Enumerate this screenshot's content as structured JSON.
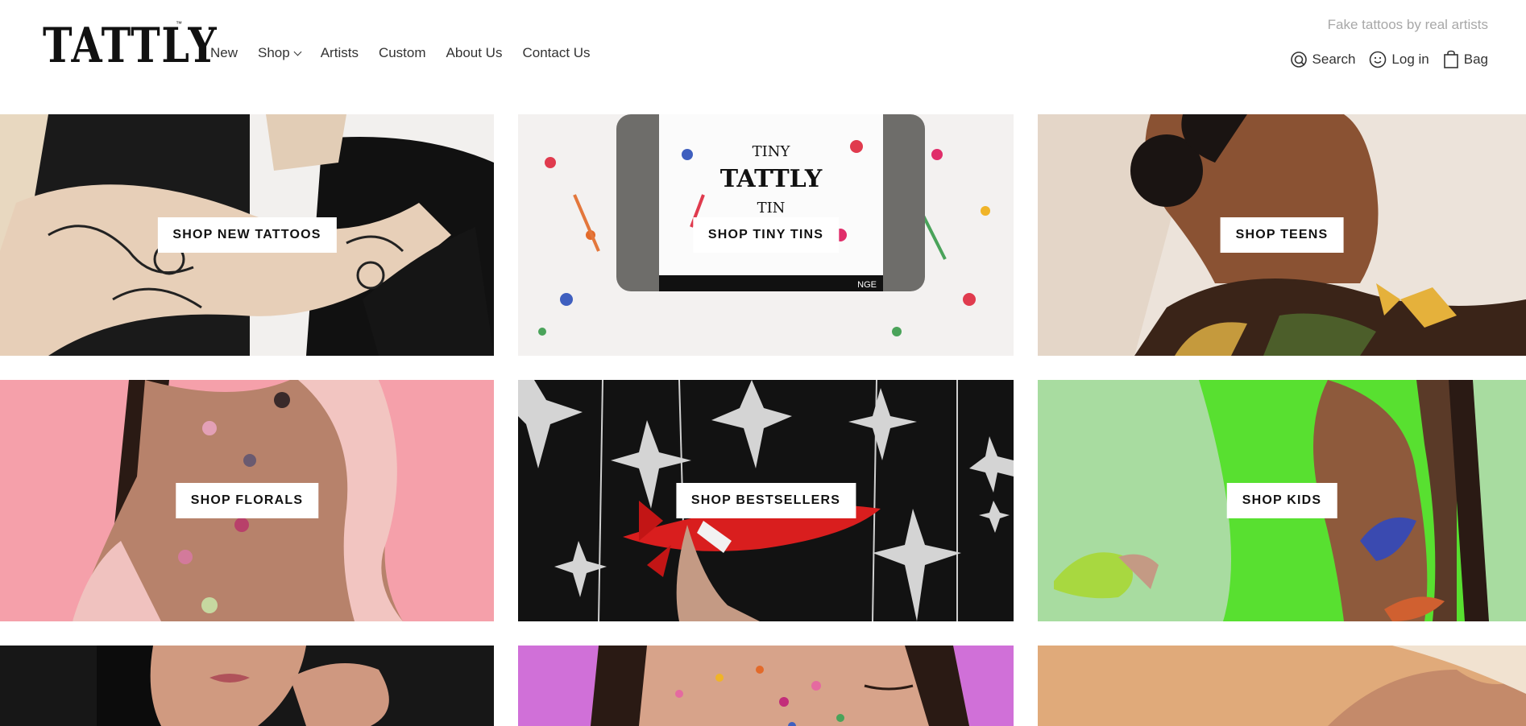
{
  "brand": {
    "logo_text": "TATTLY",
    "logo_tm": "™",
    "tagline": "Fake tattoos by real artists"
  },
  "nav": [
    {
      "label": "New"
    },
    {
      "label": "Shop"
    },
    {
      "label": "Artists"
    },
    {
      "label": "Custom"
    },
    {
      "label": "About Us"
    },
    {
      "label": "Contact Us"
    }
  ],
  "utility": {
    "search_label": "Search",
    "login_label": "Log in",
    "bag_label": "Bag"
  },
  "tiles": [
    {
      "label": "SHOP NEW TATTOOS",
      "image": "arm-sleeve-tattoos-photo"
    },
    {
      "label": "SHOP TINY TINS",
      "image": "tiny-tattly-tin-photo",
      "tin_line1": "TINY",
      "tin_line2": "TATTLY",
      "tin_line3": "TIN",
      "tin_band": "NGE"
    },
    {
      "label": "SHOP TEENS",
      "image": "teen-moth-tattoo-photo"
    },
    {
      "label": "SHOP FLORALS",
      "image": "floral-shoulder-tattoos-photo"
    },
    {
      "label": "SHOP BESTSELLERS",
      "image": "rocket-and-stars-photo"
    },
    {
      "label": "SHOP KIDS",
      "image": "kid-dinosaur-tattoos-photo"
    },
    {
      "image": "woman-portrait-photo"
    },
    {
      "image": "face-floral-tattoos-photo"
    },
    {
      "image": "shoulder-portrait-photo"
    }
  ],
  "colors": {
    "tagline": "#a8a8a8",
    "text": "#333333",
    "florals_bg": "#f5a0aa",
    "kids_bg": "#a8dca0",
    "kids_tank": "#58e030",
    "face_bg": "#d070d8"
  }
}
